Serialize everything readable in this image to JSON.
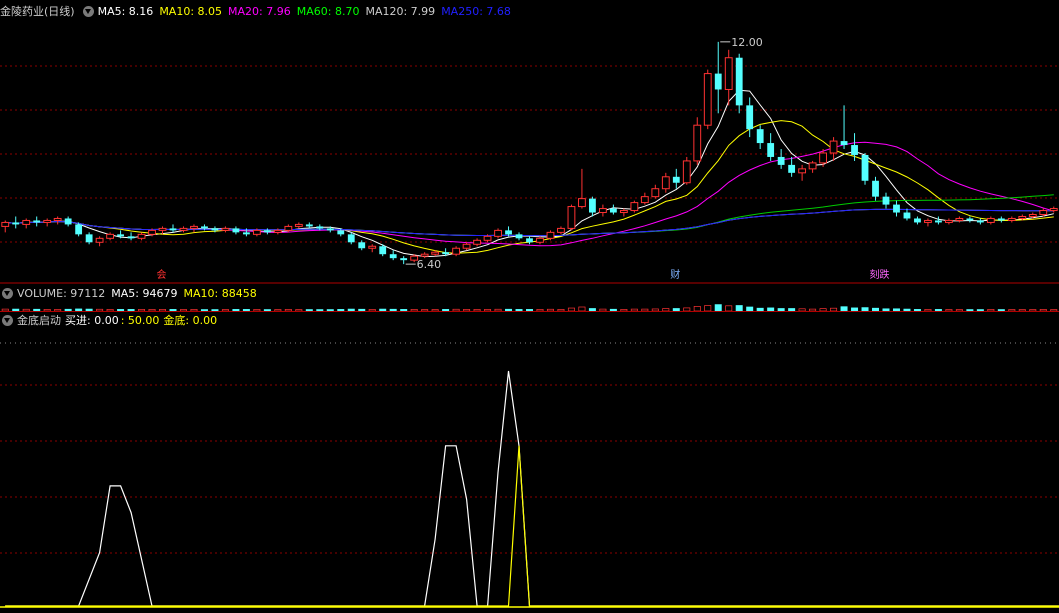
{
  "main_header": {
    "title": "金陵药业(日线)",
    "ma": [
      {
        "label": "MA5: 8.16",
        "color": "#ffffff"
      },
      {
        "label": "MA10: 8.05",
        "color": "#ffff00"
      },
      {
        "label": "MA20: 7.96",
        "color": "#ff00ff"
      },
      {
        "label": "MA60: 8.70",
        "color": "#00ff00"
      },
      {
        "label": "MA120: 7.99",
        "color": "#cccccc"
      },
      {
        "label": "MA250: 7.68",
        "color": "#2020ff"
      }
    ]
  },
  "volume_header": {
    "label": "VOLUME: 97112",
    "ma5": "MA5: 94679",
    "ma10": "MA10: 88458"
  },
  "indicator_header": {
    "name": "金底启动",
    "buy_label": "买进: 0.00",
    "ref_label": ": 50.00",
    "bottom_label": "金底: 0.00"
  },
  "annotations": {
    "high": "12.00",
    "low": "6.40",
    "marker_1": "会",
    "marker_2": "财",
    "marker_3": "刻跌"
  },
  "colors": {
    "up": "#ff3232",
    "down": "#54ffff",
    "grid": "#8b0000",
    "white": "#ffffff",
    "yellow": "#ffff00",
    "magenta": "#ff00ff",
    "green": "#00cc00",
    "blue": "#2020ff"
  },
  "chart_data": [
    {
      "type": "candlestick",
      "title": "金陵药业(日线)",
      "ylim": [
        6.0,
        12.5
      ],
      "candles": [
        [
          7.35,
          7.5,
          7.2,
          7.45
        ],
        [
          7.45,
          7.6,
          7.3,
          7.4
        ],
        [
          7.4,
          7.55,
          7.3,
          7.5
        ],
        [
          7.5,
          7.6,
          7.35,
          7.45
        ],
        [
          7.45,
          7.55,
          7.35,
          7.5
        ],
        [
          7.5,
          7.6,
          7.4,
          7.55
        ],
        [
          7.55,
          7.6,
          7.35,
          7.4
        ],
        [
          7.4,
          7.45,
          7.1,
          7.15
        ],
        [
          7.15,
          7.2,
          6.9,
          6.95
        ],
        [
          6.95,
          7.1,
          6.85,
          7.05
        ],
        [
          7.05,
          7.2,
          7.0,
          7.15
        ],
        [
          7.15,
          7.25,
          7.05,
          7.1
        ],
        [
          7.1,
          7.2,
          7.0,
          7.05
        ],
        [
          7.05,
          7.2,
          7.0,
          7.15
        ],
        [
          7.15,
          7.3,
          7.1,
          7.25
        ],
        [
          7.25,
          7.35,
          7.15,
          7.3
        ],
        [
          7.3,
          7.4,
          7.2,
          7.25
        ],
        [
          7.25,
          7.35,
          7.2,
          7.3
        ],
        [
          7.3,
          7.4,
          7.2,
          7.35
        ],
        [
          7.35,
          7.4,
          7.25,
          7.3
        ],
        [
          7.3,
          7.35,
          7.2,
          7.25
        ],
        [
          7.25,
          7.35,
          7.2,
          7.3
        ],
        [
          7.3,
          7.35,
          7.15,
          7.2
        ],
        [
          7.2,
          7.3,
          7.1,
          7.15
        ],
        [
          7.15,
          7.3,
          7.1,
          7.25
        ],
        [
          7.25,
          7.3,
          7.15,
          7.2
        ],
        [
          7.2,
          7.3,
          7.15,
          7.25
        ],
        [
          7.25,
          7.4,
          7.2,
          7.35
        ],
        [
          7.35,
          7.45,
          7.3,
          7.4
        ],
        [
          7.4,
          7.45,
          7.3,
          7.35
        ],
        [
          7.35,
          7.4,
          7.25,
          7.3
        ],
        [
          7.3,
          7.35,
          7.2,
          7.25
        ],
        [
          7.25,
          7.3,
          7.1,
          7.15
        ],
        [
          7.15,
          7.2,
          6.9,
          6.95
        ],
        [
          6.95,
          7.0,
          6.75,
          6.8
        ],
        [
          6.8,
          6.9,
          6.7,
          6.85
        ],
        [
          6.85,
          6.9,
          6.6,
          6.65
        ],
        [
          6.65,
          6.75,
          6.5,
          6.55
        ],
        [
          6.55,
          6.6,
          6.4,
          6.5
        ],
        [
          6.5,
          6.65,
          6.45,
          6.6
        ],
        [
          6.6,
          6.7,
          6.55,
          6.65
        ],
        [
          6.65,
          6.75,
          6.6,
          6.7
        ],
        [
          6.7,
          6.8,
          6.6,
          6.65
        ],
        [
          6.65,
          6.85,
          6.6,
          6.8
        ],
        [
          6.8,
          6.95,
          6.75,
          6.9
        ],
        [
          6.9,
          7.05,
          6.85,
          7.0
        ],
        [
          7.0,
          7.15,
          6.95,
          7.1
        ],
        [
          7.1,
          7.3,
          7.05,
          7.25
        ],
        [
          7.25,
          7.35,
          7.1,
          7.15
        ],
        [
          7.15,
          7.2,
          7.0,
          7.05
        ],
        [
          7.05,
          7.1,
          6.9,
          6.95
        ],
        [
          6.95,
          7.1,
          6.9,
          7.05
        ],
        [
          7.05,
          7.25,
          7.0,
          7.2
        ],
        [
          7.2,
          7.35,
          7.15,
          7.3
        ],
        [
          7.3,
          7.9,
          7.25,
          7.85
        ],
        [
          7.85,
          8.8,
          7.8,
          8.05
        ],
        [
          8.05,
          8.1,
          7.6,
          7.7
        ],
        [
          7.7,
          7.9,
          7.6,
          7.8
        ],
        [
          7.8,
          7.9,
          7.65,
          7.7
        ],
        [
          7.7,
          7.8,
          7.6,
          7.75
        ],
        [
          7.75,
          8.0,
          7.7,
          7.95
        ],
        [
          7.95,
          8.2,
          7.9,
          8.1
        ],
        [
          8.1,
          8.4,
          8.05,
          8.3
        ],
        [
          8.3,
          8.7,
          8.2,
          8.6
        ],
        [
          8.6,
          8.8,
          8.3,
          8.45
        ],
        [
          8.45,
          9.1,
          8.4,
          9.0
        ],
        [
          9.0,
          10.1,
          8.9,
          9.9
        ],
        [
          9.9,
          11.3,
          9.8,
          11.2
        ],
        [
          11.2,
          12.0,
          10.2,
          10.8
        ],
        [
          10.8,
          11.8,
          10.4,
          11.6
        ],
        [
          11.6,
          11.7,
          10.2,
          10.4
        ],
        [
          10.4,
          10.6,
          9.6,
          9.8
        ],
        [
          9.8,
          9.9,
          9.3,
          9.45
        ],
        [
          9.45,
          9.7,
          9.0,
          9.1
        ],
        [
          9.1,
          9.3,
          8.8,
          8.9
        ],
        [
          8.9,
          9.1,
          8.6,
          8.7
        ],
        [
          8.7,
          8.9,
          8.5,
          8.8
        ],
        [
          8.8,
          9.0,
          8.7,
          8.95
        ],
        [
          8.95,
          9.3,
          8.85,
          9.2
        ],
        [
          9.2,
          9.6,
          9.0,
          9.5
        ],
        [
          9.5,
          10.4,
          9.3,
          9.4
        ],
        [
          9.4,
          9.7,
          9.0,
          9.15
        ],
        [
          9.15,
          9.2,
          8.4,
          8.5
        ],
        [
          8.5,
          8.6,
          8.0,
          8.1
        ],
        [
          8.1,
          8.2,
          7.8,
          7.9
        ],
        [
          7.9,
          8.0,
          7.6,
          7.7
        ],
        [
          7.7,
          7.8,
          7.5,
          7.55
        ],
        [
          7.55,
          7.6,
          7.4,
          7.45
        ],
        [
          7.45,
          7.55,
          7.35,
          7.5
        ],
        [
          7.5,
          7.6,
          7.4,
          7.45
        ],
        [
          7.45,
          7.55,
          7.4,
          7.5
        ],
        [
          7.5,
          7.6,
          7.45,
          7.55
        ],
        [
          7.55,
          7.6,
          7.45,
          7.5
        ],
        [
          7.5,
          7.55,
          7.4,
          7.45
        ],
        [
          7.45,
          7.6,
          7.4,
          7.55
        ],
        [
          7.55,
          7.6,
          7.45,
          7.5
        ],
        [
          7.5,
          7.6,
          7.45,
          7.55
        ],
        [
          7.55,
          7.65,
          7.5,
          7.6
        ],
        [
          7.6,
          7.7,
          7.55,
          7.65
        ],
        [
          7.65,
          7.8,
          7.6,
          7.75
        ],
        [
          7.75,
          7.85,
          7.7,
          7.8
        ]
      ]
    },
    {
      "type": "line",
      "title": "金底启动",
      "ylim": [
        0,
        100
      ],
      "series": [
        {
          "name": "买进",
          "color": "#ffffff",
          "points": [
            [
              0,
              0
            ],
            [
              7,
              0
            ],
            [
              9,
              20
            ],
            [
              10,
              45
            ],
            [
              11,
              45
            ],
            [
              12,
              35
            ],
            [
              14,
              0
            ],
            [
              40,
              0
            ],
            [
              41,
              25
            ],
            [
              42,
              60
            ],
            [
              43,
              60
            ],
            [
              44,
              40
            ],
            [
              45,
              0
            ],
            [
              46,
              0
            ],
            [
              47,
              50
            ],
            [
              48,
              88
            ],
            [
              49,
              60
            ],
            [
              50,
              0
            ],
            [
              111,
              0
            ],
            [
              112,
              25
            ],
            [
              113,
              75
            ],
            [
              114,
              100
            ],
            [
              115,
              90
            ],
            [
              116,
              50
            ],
            [
              117,
              0
            ],
            [
              130,
              0
            ]
          ]
        },
        {
          "name": "金底",
          "color": "#ffff00",
          "points": [
            [
              0,
              0
            ],
            [
              48,
              0
            ],
            [
              49,
              60
            ],
            [
              50,
              0
            ],
            [
              111,
              0
            ],
            [
              112,
              0
            ],
            [
              113,
              50
            ],
            [
              114,
              80
            ],
            [
              115,
              40
            ],
            [
              116,
              0
            ],
            [
              130,
              0
            ]
          ]
        }
      ]
    }
  ]
}
